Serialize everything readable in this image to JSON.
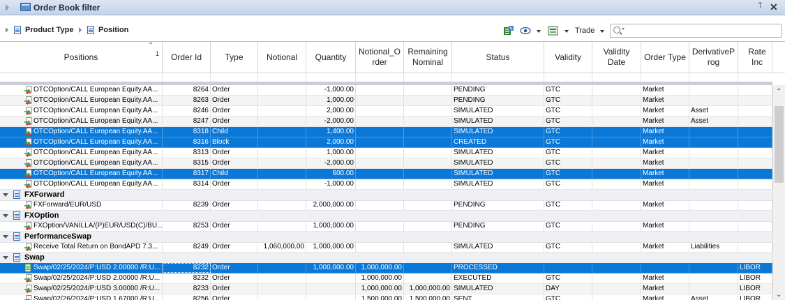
{
  "window": {
    "title": "Order Book filter",
    "pin_glyph": "⍑",
    "close_glyph": "✕"
  },
  "breadcrumb": {
    "item1": "Product Type",
    "item2": "Position"
  },
  "toolbar": {
    "trade_label": "Trade"
  },
  "search": {
    "placeholder": "",
    "value": ""
  },
  "columns": [
    "Positions",
    "Order Id",
    "Type",
    "Notional",
    "Quantity",
    "Notional_Order",
    "Remaining Nominal",
    "Status",
    "Validity",
    "Validity Date",
    "Order Type",
    "DerivativeProg",
    "Rate Ind"
  ],
  "header": {
    "positions": "Positions",
    "sort_rank": "1",
    "order_id": "Order Id",
    "type": "Type",
    "notional": "Notional",
    "quantity": "Quantity",
    "notional_order": "Notional_O rder",
    "remaining": "Remaining Nominal",
    "status": "Status",
    "validity": "Validity",
    "validity_date": "Validity Date",
    "order_type": "Order Type",
    "derivative_prog": "DerivativeP rog",
    "rate_ind": "Rate Inc"
  },
  "groups": {
    "fxforward": "FXForward",
    "fxoption": "FXOption",
    "performanceswap": "PerformanceSwap",
    "swap": "Swap"
  },
  "rows": {
    "r1": {
      "pos": "OTCOption/CALL European Equity.AA...",
      "id": "8264",
      "type": "Order",
      "notional": "",
      "qty": "-1,000.00",
      "norder": "",
      "rem": "",
      "status": "PENDING",
      "validity": "GTC",
      "vdate": "",
      "otype": "Market",
      "dprog": "",
      "rate": ""
    },
    "r2": {
      "pos": "OTCOption/CALL European Equity.AA...",
      "id": "8263",
      "type": "Order",
      "notional": "",
      "qty": "1,000.00",
      "norder": "",
      "rem": "",
      "status": "PENDING",
      "validity": "GTC",
      "vdate": "",
      "otype": "Market",
      "dprog": "",
      "rate": ""
    },
    "r3": {
      "pos": "OTCOption/CALL European Equity.AA...",
      "id": "8246",
      "type": "Order",
      "notional": "",
      "qty": "2,000.00",
      "norder": "",
      "rem": "",
      "status": "SIMULATED",
      "validity": "GTC",
      "vdate": "",
      "otype": "Market",
      "dprog": "Asset",
      "rate": ""
    },
    "r4": {
      "pos": "OTCOption/CALL European Equity.AA...",
      "id": "8247",
      "type": "Order",
      "notional": "",
      "qty": "-2,000.00",
      "norder": "",
      "rem": "",
      "status": "SIMULATED",
      "validity": "GTC",
      "vdate": "",
      "otype": "Market",
      "dprog": "Asset",
      "rate": ""
    },
    "r5": {
      "pos": "OTCOption/CALL European Equity.AA...",
      "id": "8318",
      "type": "Child",
      "notional": "",
      "qty": "1,400.00",
      "norder": "",
      "rem": "",
      "status": "SIMULATED",
      "validity": "GTC",
      "vdate": "",
      "otype": "Market",
      "dprog": "",
      "rate": ""
    },
    "r6": {
      "pos": "OTCOption/CALL European Equity.AA...",
      "id": "8316",
      "type": "Block",
      "notional": "",
      "qty": "2,000.00",
      "norder": "",
      "rem": "",
      "status": "CREATED",
      "validity": "GTC",
      "vdate": "",
      "otype": "Market",
      "dprog": "",
      "rate": ""
    },
    "r7": {
      "pos": "OTCOption/CALL European Equity.AA...",
      "id": "8313",
      "type": "Order",
      "notional": "",
      "qty": "1,000.00",
      "norder": "",
      "rem": "",
      "status": "SIMULATED",
      "validity": "GTC",
      "vdate": "",
      "otype": "Market",
      "dprog": "",
      "rate": ""
    },
    "r8": {
      "pos": "OTCOption/CALL European Equity.AA...",
      "id": "8315",
      "type": "Order",
      "notional": "",
      "qty": "-2,000.00",
      "norder": "",
      "rem": "",
      "status": "SIMULATED",
      "validity": "GTC",
      "vdate": "",
      "otype": "Market",
      "dprog": "",
      "rate": ""
    },
    "r9": {
      "pos": "OTCOption/CALL European Equity.AA...",
      "id": "8317",
      "type": "Child",
      "notional": "",
      "qty": "600.00",
      "norder": "",
      "rem": "",
      "status": "SIMULATED",
      "validity": "GTC",
      "vdate": "",
      "otype": "Market",
      "dprog": "",
      "rate": ""
    },
    "r10": {
      "pos": "OTCOption/CALL European Equity.AA...",
      "id": "8314",
      "type": "Order",
      "notional": "",
      "qty": "-1,000.00",
      "norder": "",
      "rem": "",
      "status": "SIMULATED",
      "validity": "GTC",
      "vdate": "",
      "otype": "Market",
      "dprog": "",
      "rate": ""
    },
    "r11": {
      "pos": "FXForward/EUR/USD",
      "id": "8239",
      "type": "Order",
      "notional": "",
      "qty": "2,000,000.00",
      "norder": "",
      "rem": "",
      "status": "PENDING",
      "validity": "GTC",
      "vdate": "",
      "otype": "Market",
      "dprog": "",
      "rate": ""
    },
    "r12": {
      "pos": "FXOption/VANILLA/(P)EUR/USD(C)/BU...",
      "id": "8253",
      "type": "Order",
      "notional": "",
      "qty": "1,000,000.00",
      "norder": "",
      "rem": "",
      "status": "PENDING",
      "validity": "GTC",
      "vdate": "",
      "otype": "Market",
      "dprog": "",
      "rate": ""
    },
    "r13": {
      "pos": "Receive Total Return on BondAPD 7.3...",
      "id": "8249",
      "type": "Order",
      "notional": "1,060,000.00",
      "qty": "1,000,000.00",
      "norder": "",
      "rem": "",
      "status": "SIMULATED",
      "validity": "GTC",
      "vdate": "",
      "otype": "Market",
      "dprog": "Liabilities",
      "rate": ""
    },
    "r14": {
      "pos": "Swap/02/25/2024/P:USD 2.00000 /R:U...",
      "id": "8232",
      "type": "Order",
      "notional": "",
      "qty": "1,000,000.00",
      "norder": "1,000,000.00",
      "rem": "",
      "status": "PROCESSED",
      "validity": "",
      "vdate": "",
      "otype": "",
      "dprog": "",
      "rate": "LIBOR"
    },
    "r15": {
      "pos": "Swap/02/25/2024/P:USD 2.00000 /R:U...",
      "id": "8232",
      "type": "Order",
      "notional": "",
      "qty": "",
      "norder": "1,000,000.00",
      "rem": "",
      "status": "EXECUTED",
      "validity": "GTC",
      "vdate": "",
      "otype": "Market",
      "dprog": "",
      "rate": "LIBOR"
    },
    "r16": {
      "pos": "Swap/02/25/2024/P:USD 3.00000 /R:U...",
      "id": "8233",
      "type": "Order",
      "notional": "",
      "qty": "",
      "norder": "1,000,000.00",
      "rem": "1,000,000.00",
      "status": "SIMULATED",
      "validity": "DAY",
      "vdate": "",
      "otype": "Market",
      "dprog": "",
      "rate": "LIBOR"
    },
    "r17": {
      "pos": "Swap/02/26/2024/P:USD 1.67000 /R:U...",
      "id": "8256",
      "type": "Order",
      "notional": "",
      "qty": "",
      "norder": "1,500,000.00",
      "rem": "1,500,000.00",
      "status": "SENT",
      "validity": "GTC",
      "vdate": "",
      "otype": "Market",
      "dprog": "Asset",
      "rate": "LIBOR"
    }
  },
  "colors": {
    "selection": "#0a78d7",
    "title_bar": "#c4d3e8"
  }
}
